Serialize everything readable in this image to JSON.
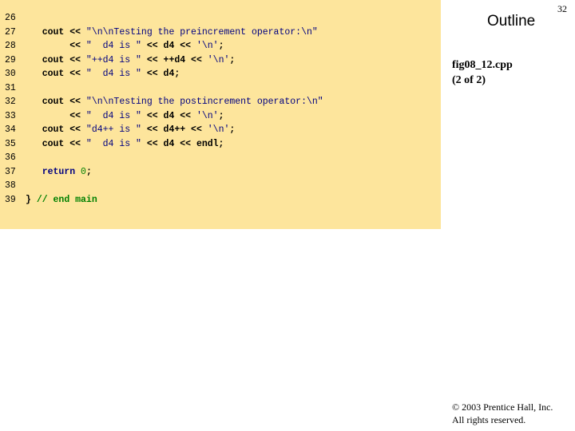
{
  "slide": {
    "number": "32",
    "outline_title": "Outline",
    "caption_line1": "fig08_12.cpp",
    "caption_line2": "(2 of 2)",
    "copyright_line1": "© 2003 Prentice Hall, Inc.",
    "copyright_line2": "All rights reserved."
  },
  "code": {
    "lines": [
      {
        "num": "26",
        "parts": []
      },
      {
        "num": "27",
        "parts": [
          {
            "t": "   cout << ",
            "c": ""
          },
          {
            "t": "\"\\n\\nTesting the preincrement operator:\\n\"",
            "c": "str"
          }
        ]
      },
      {
        "num": "28",
        "parts": [
          {
            "t": "        << ",
            "c": ""
          },
          {
            "t": "\"  d4 is \"",
            "c": "str"
          },
          {
            "t": " << d4 << ",
            "c": ""
          },
          {
            "t": "'\\n'",
            "c": "str"
          },
          {
            "t": ";",
            "c": ""
          }
        ]
      },
      {
        "num": "29",
        "parts": [
          {
            "t": "   cout << ",
            "c": ""
          },
          {
            "t": "\"++d4 is \"",
            "c": "str"
          },
          {
            "t": " << ++d4 << ",
            "c": ""
          },
          {
            "t": "'\\n'",
            "c": "str"
          },
          {
            "t": ";",
            "c": ""
          }
        ]
      },
      {
        "num": "30",
        "parts": [
          {
            "t": "   cout << ",
            "c": ""
          },
          {
            "t": "\"  d4 is \"",
            "c": "str"
          },
          {
            "t": " << d4;",
            "c": ""
          }
        ]
      },
      {
        "num": "31",
        "parts": []
      },
      {
        "num": "32",
        "parts": [
          {
            "t": "   cout << ",
            "c": ""
          },
          {
            "t": "\"\\n\\nTesting the postincrement operator:\\n\"",
            "c": "str"
          }
        ]
      },
      {
        "num": "33",
        "parts": [
          {
            "t": "        << ",
            "c": ""
          },
          {
            "t": "\"  d4 is \"",
            "c": "str"
          },
          {
            "t": " << d4 << ",
            "c": ""
          },
          {
            "t": "'\\n'",
            "c": "str"
          },
          {
            "t": ";",
            "c": ""
          }
        ]
      },
      {
        "num": "34",
        "parts": [
          {
            "t": "   cout << ",
            "c": ""
          },
          {
            "t": "\"d4++ is \"",
            "c": "str"
          },
          {
            "t": " << d4++ << ",
            "c": ""
          },
          {
            "t": "'\\n'",
            "c": "str"
          },
          {
            "t": ";",
            "c": ""
          }
        ]
      },
      {
        "num": "35",
        "parts": [
          {
            "t": "   cout << ",
            "c": ""
          },
          {
            "t": "\"  d4 is \"",
            "c": "str"
          },
          {
            "t": " << d4 << endl;",
            "c": ""
          }
        ]
      },
      {
        "num": "36",
        "parts": []
      },
      {
        "num": "37",
        "parts": [
          {
            "t": "   ",
            "c": ""
          },
          {
            "t": "return",
            "c": "kw"
          },
          {
            "t": " ",
            "c": ""
          },
          {
            "t": "0",
            "c": "num"
          },
          {
            "t": ";",
            "c": ""
          }
        ]
      },
      {
        "num": "38",
        "parts": []
      },
      {
        "num": "39",
        "parts": [
          {
            "t": "} ",
            "c": ""
          },
          {
            "t": "// end main",
            "c": "cm"
          }
        ]
      }
    ]
  }
}
